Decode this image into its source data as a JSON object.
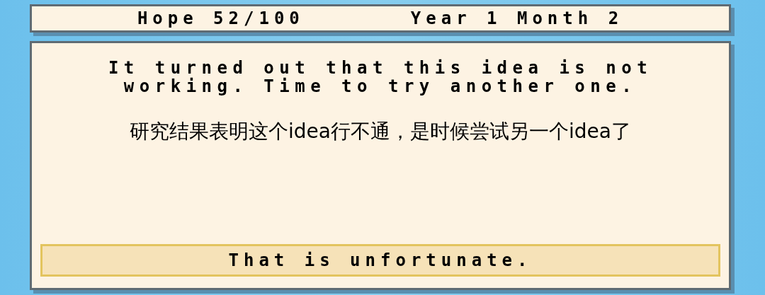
{
  "status_bar": {
    "hope": "Hope 52/100",
    "date": "Year 1 Month 2"
  },
  "dialog": {
    "message": "It turned out that this idea is not working. Time to try another one.",
    "translation": "研究结果表明这个idea行不通，是时候尝试另一个idea了",
    "buttons": [
      "That is unfortunate."
    ]
  }
}
